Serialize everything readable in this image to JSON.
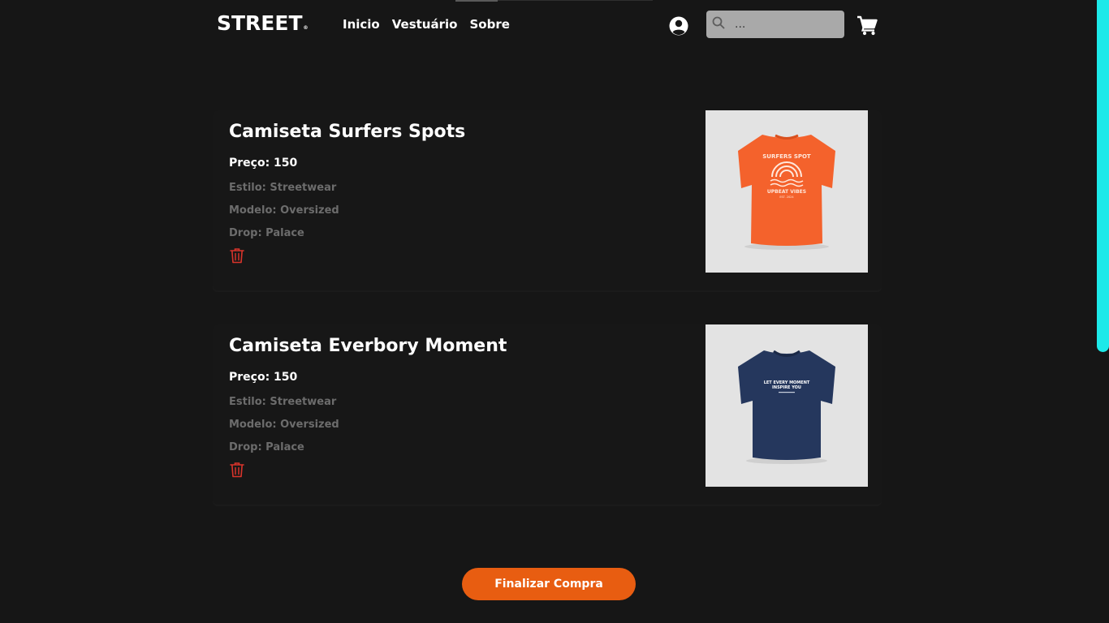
{
  "header": {
    "logo": "STREET",
    "logo_mark": "®",
    "nav": [
      "Inicio",
      "Vestuário",
      "Sobre"
    ],
    "search_placeholder": "..."
  },
  "cart": {
    "items": [
      {
        "title": "Camiseta Surfers Spots",
        "price": "Preço: 150",
        "estilo": "Estilo: Streetwear",
        "modelo": "Modelo: Oversized",
        "drop": "Drop: Palace",
        "shirt_color": "#f4622c",
        "print_lines": [
          "SURFERS SPOT",
          "UPBEAT VIBES",
          "EST. 2024"
        ]
      },
      {
        "title": "Camiseta Everbory Moment",
        "price": "Preço: 150",
        "estilo": "Estilo: Streetwear",
        "modelo": "Modelo: Oversized",
        "drop": "Drop: Palace",
        "shirt_color": "#25375d",
        "print_lines": [
          "LET EVERY MOMENT",
          "INSPIRE YOU"
        ]
      }
    ],
    "checkout_label": "Finalizar Compra"
  },
  "colors": {
    "background": "#161616",
    "accent": "#e85d11",
    "delete": "#d9342b",
    "scrollbar": "#1de9e9"
  }
}
